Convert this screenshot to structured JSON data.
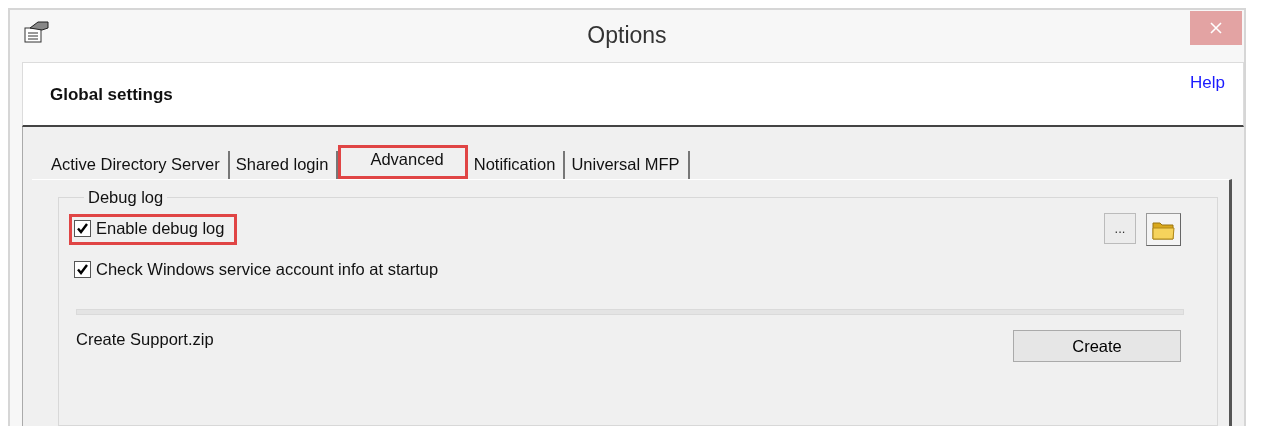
{
  "window": {
    "title": "Options"
  },
  "header": {
    "title": "Global settings",
    "help_link": "Help"
  },
  "tabs": [
    {
      "label": "Active Directory Server",
      "selected": false,
      "highlighted": false
    },
    {
      "label": "Shared login",
      "selected": false,
      "highlighted": false
    },
    {
      "label": "Advanced",
      "selected": true,
      "highlighted": true
    },
    {
      "label": "Notification",
      "selected": false,
      "highlighted": false
    },
    {
      "label": "Universal MFP",
      "selected": false,
      "highlighted": false
    }
  ],
  "debug_log": {
    "title": "Debug log",
    "browse_button": "...",
    "options": [
      {
        "label": "Enable debug log",
        "checked": true,
        "highlighted": true
      },
      {
        "label": "Check Windows service account info at startup",
        "checked": true,
        "highlighted": false
      }
    ],
    "support_label": "Create Support.zip",
    "create_button": "Create"
  }
}
